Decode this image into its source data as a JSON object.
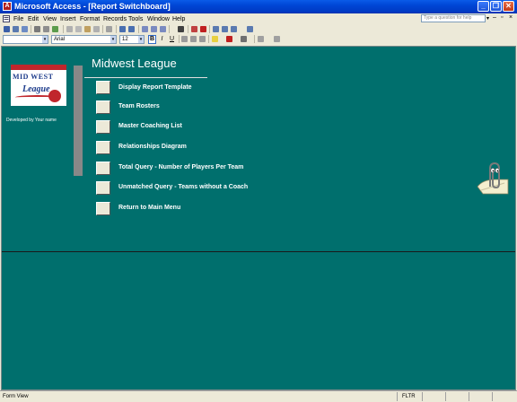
{
  "window": {
    "title": "Microsoft Access - [Report Switchboard]",
    "app_icon_letter": "A",
    "minimize_glyph": "_",
    "maximize_glyph": "❐",
    "close_glyph": "✕"
  },
  "menu": {
    "items": [
      "File",
      "Edit",
      "View",
      "Insert",
      "Format",
      "Records",
      "Tools",
      "Window",
      "Help"
    ],
    "help_placeholder": "Type a question for help"
  },
  "format_toolbar": {
    "font_name": "Arial",
    "font_size": "12",
    "bold_label": "B",
    "italic_label": "I",
    "underline_label": "U"
  },
  "form": {
    "heading": "Midwest League",
    "developed_by": "Developed by Your name",
    "logo": {
      "line1": "MID WEST",
      "line2": "League"
    },
    "buttons": [
      {
        "label": "Display Report Template"
      },
      {
        "label": "Team Rosters"
      },
      {
        "label": "Master Coaching List"
      },
      {
        "label": "Relationships Diagram"
      },
      {
        "label": "Total Query - Number of Players Per Team"
      },
      {
        "label": "Unmatched Query - Teams without a Coach"
      },
      {
        "label": "Return to Main Menu"
      }
    ]
  },
  "status": {
    "view": "Form View",
    "filter": "FLTR"
  },
  "colors": {
    "form_background": "#006f6d",
    "titlebar": "#0046d5",
    "logo_red": "#c0262c",
    "logo_blue": "#1b3a8a"
  },
  "icons": {
    "assistant": "clippy-icon"
  }
}
